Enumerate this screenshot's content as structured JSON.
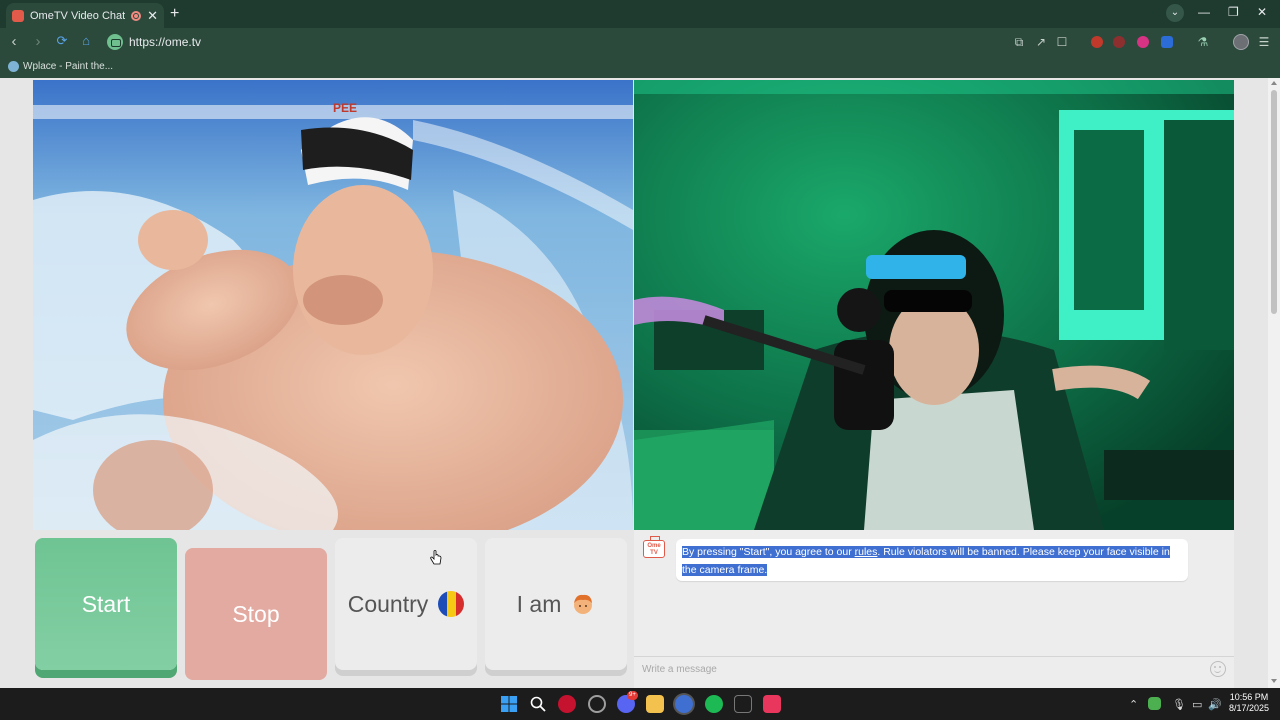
{
  "browser": {
    "tab_title": "OmeTV Video Chat — Omegle",
    "new_tab_label": "+",
    "url": "https://ome.tv",
    "bookmark_label": "Wplace - Paint the..."
  },
  "controls": {
    "start_label": "Start",
    "stop_label": "Stop",
    "country_label": "Country",
    "iam_label": "I am"
  },
  "chat": {
    "logo_text": "Ome TV",
    "message_before": "By pressing \"Start\", you agree to our ",
    "message_link": "rules",
    "message_after": ". Rule violators will be banned. Please keep your face visible in the camera frame.",
    "input_placeholder": "Write a message"
  },
  "taskbar": {
    "time": "10:56 PM",
    "date": "8/17/2025",
    "discord_badge": "9+"
  },
  "colors": {
    "start_green": "#6fc493",
    "stop_red": "#e3aaa2",
    "brand_red": "#e05a4a",
    "selection_blue": "#3f6fd1"
  }
}
